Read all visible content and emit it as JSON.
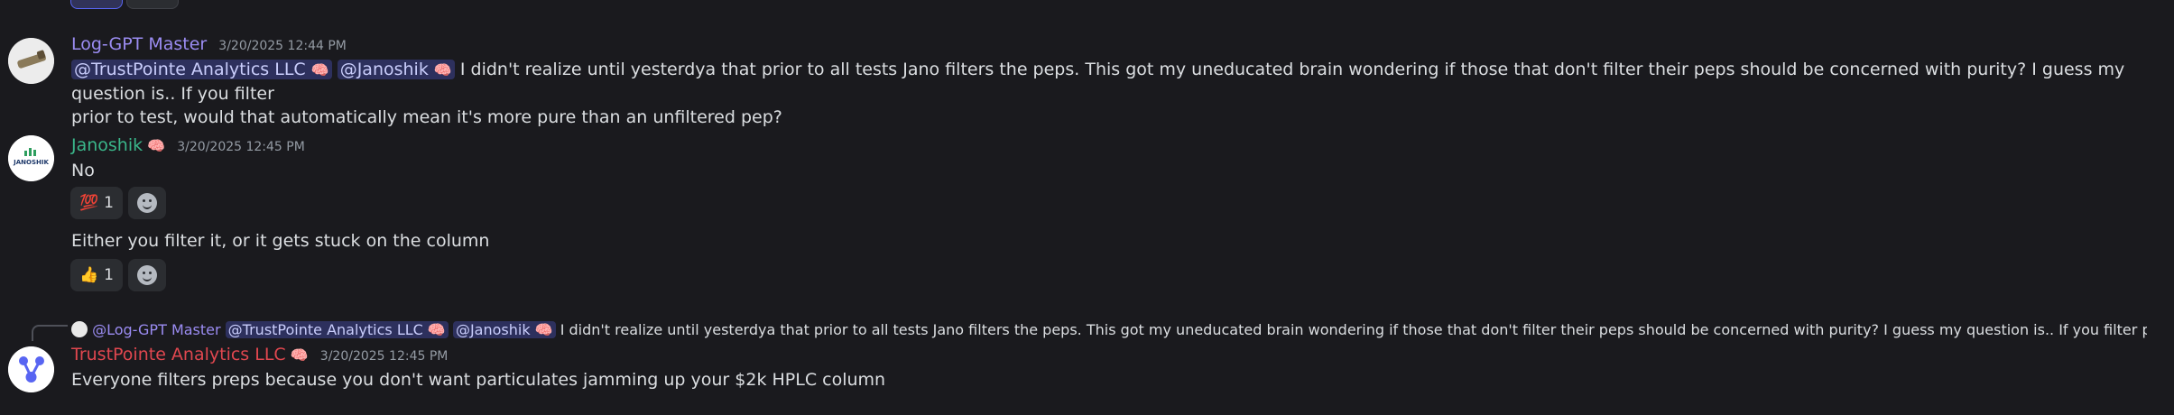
{
  "messages": {
    "m1": {
      "username": "Log-GPT Master",
      "username_color": "#9b8cf2",
      "timestamp": "3/20/2025 12:44 PM",
      "mention1": "@TrustPointe Analytics LLC",
      "mention2": "@Janoshik",
      "text_line1": "I didn't realize until yesterdya that prior to all tests Jano filters the peps. This got my uneducated brain wondering if those that don't filter their peps should be concerned with purity?  I guess my question is..  If you filter",
      "text_line2": "prior to test, would that automatically mean it's more pure than an unfiltered pep?"
    },
    "m2": {
      "username": "Janoshik",
      "username_color": "#3ab68a",
      "timestamp": "3/20/2025 12:45 PM",
      "avatar_text": "JANOSHIK",
      "text": "No",
      "reaction_emoji": "💯",
      "reaction_count": "1"
    },
    "m3": {
      "text": "Either you filter it, or it gets stuck on the column",
      "reaction_emoji": "👍",
      "reaction_count": "1"
    },
    "reply": {
      "username": "@Log-GPT Master",
      "mention1": "@TrustPointe Analytics LLC",
      "mention2": "@Janoshik",
      "text": "I didn't realize until yesterdya that prior to all tests Jano filters the peps. This got my uneducated brain wondering if those that don't filter their peps should be concerned with purity?  I guess my question is..  If you filter prior to test, woul..."
    },
    "m4": {
      "username": "TrustPointe Analytics LLC",
      "username_color": "#e0474f",
      "timestamp": "3/20/2025 12:45 PM",
      "text": "Everyone filters preps because you don't want particulates jamming up your $2k HPLC column"
    }
  }
}
